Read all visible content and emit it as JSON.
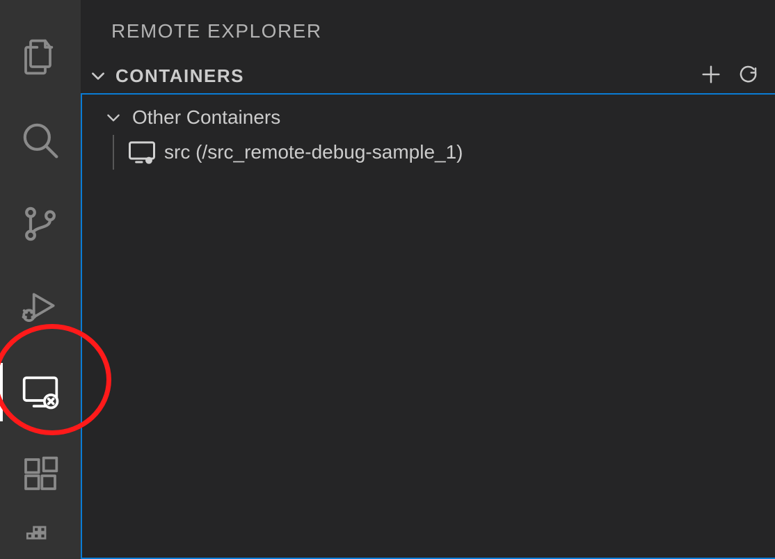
{
  "activityBar": {
    "items": [
      {
        "name": "explorer",
        "active": false
      },
      {
        "name": "search",
        "active": false
      },
      {
        "name": "source-control",
        "active": false
      },
      {
        "name": "run-debug",
        "active": false
      },
      {
        "name": "remote-explorer",
        "active": true
      },
      {
        "name": "extensions",
        "active": false
      },
      {
        "name": "more",
        "active": false
      }
    ]
  },
  "sidePanel": {
    "title": "REMOTE EXPLORER",
    "section": {
      "label": "CONTAINERS",
      "expanded": true,
      "actions": {
        "add": "Add",
        "refresh": "Refresh"
      },
      "groups": [
        {
          "label": "Other Containers",
          "expanded": true,
          "items": [
            {
              "label": "src (/src_remote-debug-sample_1)"
            }
          ]
        }
      ]
    }
  },
  "annotation": {
    "highlighted_item": "remote-explorer"
  }
}
